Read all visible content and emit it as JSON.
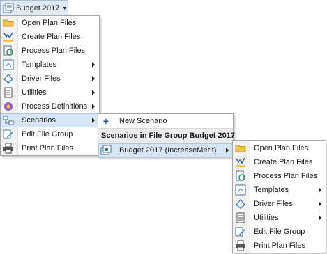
{
  "top_button": {
    "label": "Budget 2017"
  },
  "main_menu": {
    "items": [
      {
        "label": "Open Plan Files",
        "icon": "folder-icon"
      },
      {
        "label": "Create Plan Files",
        "icon": "create-document-icon"
      },
      {
        "label": "Process Plan Files",
        "icon": "process-document-icon"
      },
      {
        "label": "Templates",
        "icon": "templates-icon"
      },
      {
        "label": "Driver Files",
        "icon": "driver-files-icon"
      },
      {
        "label": "Utilities",
        "icon": "utilities-icon"
      },
      {
        "label": "Process Definitions",
        "icon": "process-definitions-icon"
      },
      {
        "label": "Scenarios",
        "icon": "scenarios-icon"
      },
      {
        "label": "Edit File Group",
        "icon": "edit-icon"
      },
      {
        "label": "Print Plan Files",
        "icon": "printer-icon"
      }
    ]
  },
  "scenarios_menu": {
    "new_scenario": "New Scenario",
    "header": "Scenarios in File Group Budget 2017",
    "scenario_item": "Budget 2017 (IncreaseMerit)"
  },
  "scenario_submenu": {
    "items": [
      {
        "label": "Open Plan Files"
      },
      {
        "label": "Create Plan Files"
      },
      {
        "label": "Process Plan Files"
      },
      {
        "label": "Templates"
      },
      {
        "label": "Driver Files"
      },
      {
        "label": "Utilities"
      },
      {
        "label": "Edit File Group"
      },
      {
        "label": "Print Plan Files"
      }
    ]
  },
  "colors": {
    "highlight": "#d7e6f7",
    "gutter": "#f2f2f2",
    "folder": "#f0c15a",
    "blue_icon": "#3a78c2"
  }
}
